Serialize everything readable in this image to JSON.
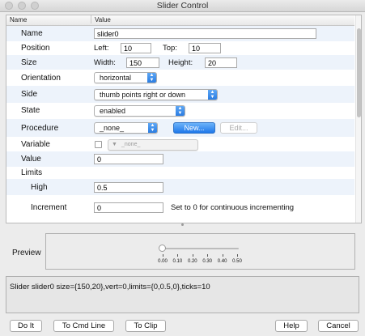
{
  "window": {
    "title": "Slider Control"
  },
  "grid": {
    "headers": {
      "name": "Name",
      "value": "Value"
    },
    "rows": {
      "name": {
        "label": "Name",
        "value": "slider0"
      },
      "position": {
        "label": "Position",
        "left_label": "Left:",
        "left_value": "10",
        "top_label": "Top:",
        "top_value": "10"
      },
      "size": {
        "label": "Size",
        "width_label": "Width:",
        "width_value": "150",
        "height_label": "Height:",
        "height_value": "20"
      },
      "orientation": {
        "label": "Orientation",
        "value": "horizontal"
      },
      "side": {
        "label": "Side",
        "value": "thumb points right or down"
      },
      "state": {
        "label": "State",
        "value": "enabled"
      },
      "procedure": {
        "label": "Procedure",
        "value": "_none_",
        "new_label": "New...",
        "edit_label": "Edit..."
      },
      "variable": {
        "label": "Variable",
        "value": "_none_",
        "checked": false
      },
      "value": {
        "label": "Value",
        "value": "0"
      },
      "limits": {
        "label": "Limits"
      },
      "high": {
        "label": "High",
        "value": "0.5"
      },
      "increment": {
        "label": "Increment",
        "value": "0",
        "hint": "Set to 0 for continuous incrementing"
      }
    }
  },
  "preview": {
    "label": "Preview",
    "slider_fraction": 0.0,
    "ticks": [
      "0.00",
      "0.10",
      "0.20",
      "0.30",
      "0.40",
      "0.50"
    ]
  },
  "command": {
    "text": "Slider slider0 size={150,20},vert=0,limits={0,0.5,0},ticks=10"
  },
  "buttons": {
    "do_it": "Do It",
    "to_cmd_line": "To Cmd Line",
    "to_clip": "To Clip",
    "help": "Help",
    "cancel": "Cancel"
  },
  "colors": {
    "accent": "#2b7de2",
    "row_alt": "#edf3fb"
  }
}
